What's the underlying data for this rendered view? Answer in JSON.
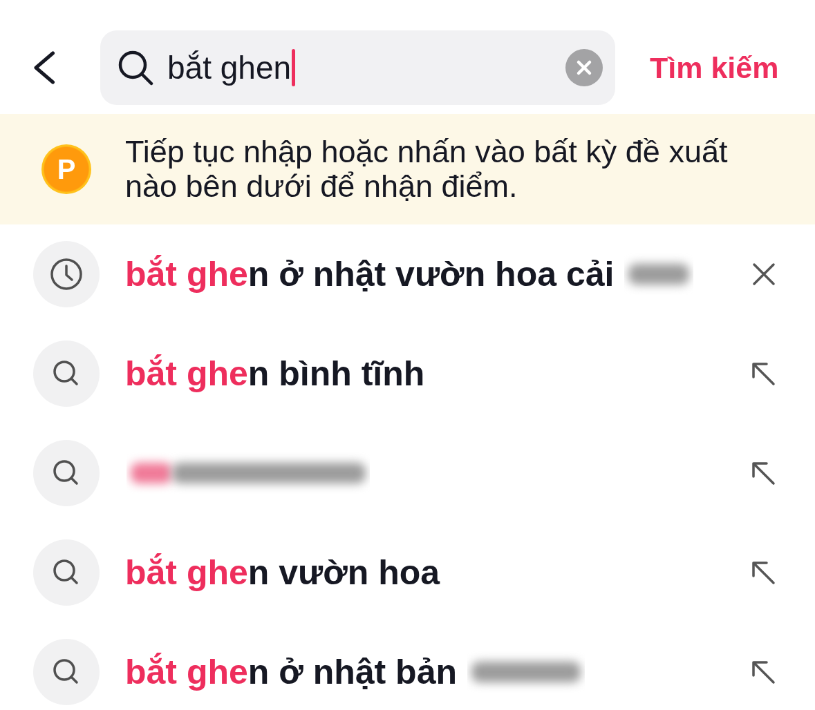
{
  "header": {
    "search": {
      "value": "bắt ghen",
      "focused": true
    },
    "action": "Tìm kiếm"
  },
  "banner": {
    "badge": "P",
    "message": "Tiếp tục nhập hoặc nhấn vào bất kỳ đề xuất nào bên dưới để nhận điểm."
  },
  "suggestions": [
    {
      "kind": "history",
      "match": "bắt ghe",
      "rest": "n ở nhật vườn hoa cải",
      "blurred": true
    },
    {
      "kind": "suggestion",
      "match": "bắt ghe",
      "rest": "n bình tĩnh",
      "blurred": false
    },
    {
      "kind": "suggestion",
      "blurred": true
    },
    {
      "kind": "suggestion",
      "match": "bắt ghe",
      "rest": "n vườn hoa",
      "blurred": false
    },
    {
      "kind": "suggestion",
      "match": "bắt ghe",
      "rest": "n ở nhật bản",
      "blurred": true
    }
  ]
}
